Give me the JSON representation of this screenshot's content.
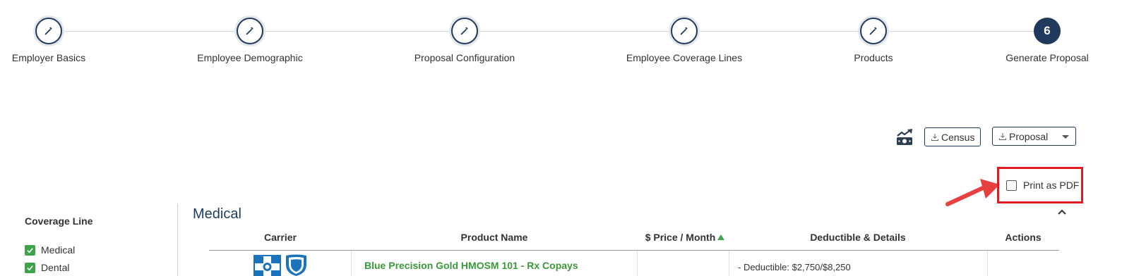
{
  "stepper": {
    "steps": [
      {
        "label": "Employer Basics",
        "state": "done",
        "icon": "pencil-icon"
      },
      {
        "label": "Employee Demographic",
        "state": "done",
        "icon": "pencil-icon"
      },
      {
        "label": "Proposal Configuration",
        "state": "done",
        "icon": "pencil-icon"
      },
      {
        "label": "Employee Coverage Lines",
        "state": "done",
        "icon": "pencil-icon"
      },
      {
        "label": "Products",
        "state": "done",
        "icon": "pencil-icon"
      },
      {
        "label": "Generate Proposal",
        "state": "current",
        "number": "6"
      }
    ]
  },
  "toolbar": {
    "money_icon": "money-trend-icon",
    "census_label": "Census",
    "proposal_label": "Proposal"
  },
  "print_pdf": {
    "label": "Print as PDF",
    "checked": false
  },
  "sidebar": {
    "title": "Coverage Line",
    "items": [
      {
        "label": "Medical",
        "checked": true
      },
      {
        "label": "Dental",
        "checked": true
      }
    ]
  },
  "main": {
    "section_title": "Medical",
    "columns": {
      "carrier": "Carrier",
      "product_name": "Product Name",
      "price": "$ Price / Month",
      "deductible": "Deductible & Details",
      "actions": "Actions"
    },
    "rows": [
      {
        "carrier_logo": "blue-cross-blue-shield-logo",
        "product_name": "Blue Precision Gold HMOSM 101 - Rx Copays",
        "deductible": "- Deductible: $2,750/$8,250"
      }
    ]
  },
  "colors": {
    "navy": "#1f3a5c",
    "green": "#3fa34d",
    "highlight_red": "#e01b22"
  }
}
